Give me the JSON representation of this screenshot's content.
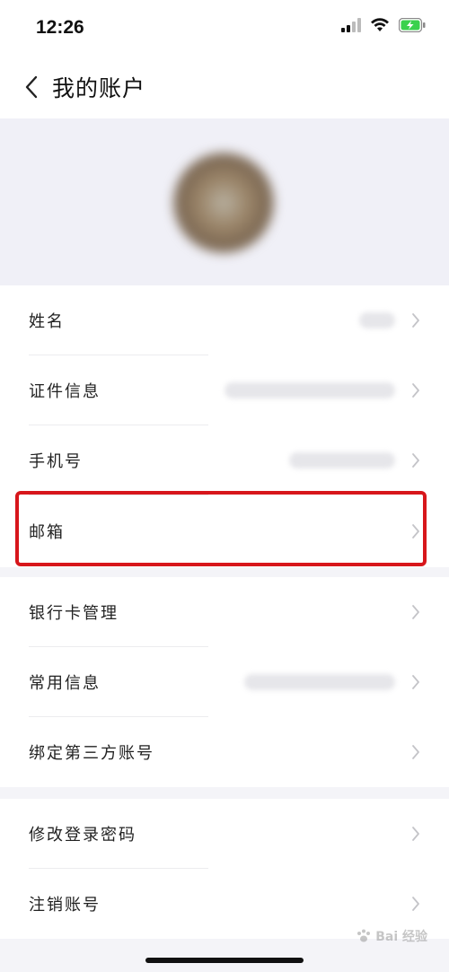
{
  "status_bar": {
    "time": "12:26"
  },
  "nav": {
    "title": "我的账户"
  },
  "groups": [
    {
      "rows": [
        {
          "label": "姓名",
          "value_width": 40
        },
        {
          "label": "证件信息",
          "value_width": 190
        },
        {
          "label": "手机号",
          "value_width": 118
        },
        {
          "label": "邮箱",
          "value_width": 0
        }
      ]
    },
    {
      "rows": [
        {
          "label": "银行卡管理",
          "value_width": 0
        },
        {
          "label": "常用信息",
          "value_width": 168
        },
        {
          "label": "绑定第三方账号",
          "value_width": 0
        }
      ]
    },
    {
      "rows": [
        {
          "label": "修改登录密码",
          "value_width": 0
        },
        {
          "label": "注销账号",
          "value_width": 0
        }
      ]
    }
  ],
  "watermark": {
    "text": "Bai 经验"
  },
  "colors": {
    "highlight": "#d7161b",
    "battery": "#3bd14d",
    "chevron": "#c4c4c8"
  }
}
